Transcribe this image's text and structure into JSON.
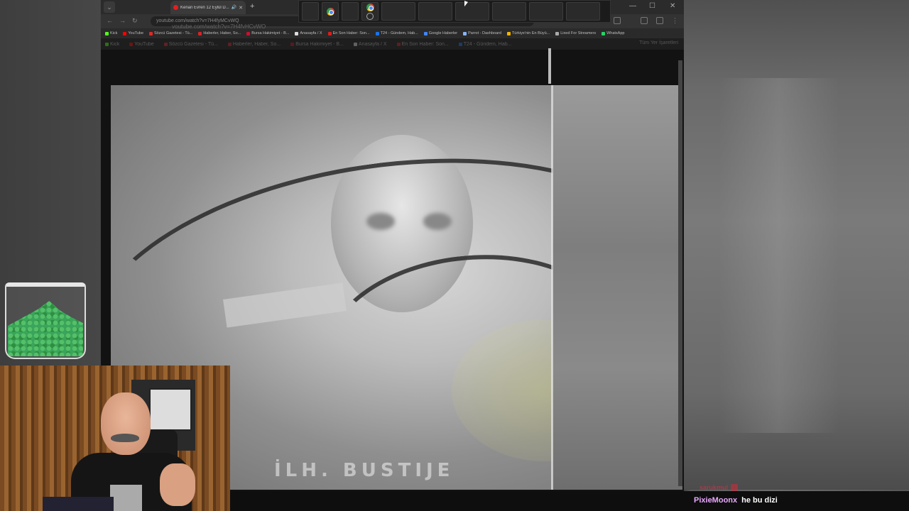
{
  "browser": {
    "tab_title": "Kenan Evren 12 Eylül D...",
    "tab_close": "✕",
    "new_tab": "+",
    "window_controls": [
      "—",
      "☐",
      "✕"
    ],
    "url": "youtube.com/watch?v=7H4fyMCvWQ",
    "url_ghost": "youtube.com/watch?v=7H4fyHCvWQ"
  },
  "bookmarks": [
    {
      "label": "Kick",
      "color": "#53fc18"
    },
    {
      "label": "YouTube",
      "color": "#ff0000"
    },
    {
      "label": "Sözcü Gazetesi - Tü...",
      "color": "#e02828"
    },
    {
      "label": "Haberler, Haber, So...",
      "color": "#d0262b"
    },
    {
      "label": "Bursa Hakimiyet - B...",
      "color": "#c8102e"
    },
    {
      "label": "Anasayfa / X",
      "color": "#dddddd"
    },
    {
      "label": "En Son Haber: Son...",
      "color": "#d42020"
    },
    {
      "label": "T24 - Gündem, Hab...",
      "color": "#1a73e8"
    },
    {
      "label": "Google Haberler",
      "color": "#4285f4"
    },
    {
      "label": "Parrot - Dashboard",
      "color": "#8ab4f8"
    },
    {
      "label": "Türkiye'nin En Büyü...",
      "color": "#f4b400"
    },
    {
      "label": "Lixed For Streamers",
      "color": "#aaaaaa"
    },
    {
      "label": "WhatsApp",
      "color": "#25d366"
    }
  ],
  "bookmarks_ghost": [
    {
      "label": "Kick",
      "color": "#53fc18"
    },
    {
      "label": "YouTube",
      "color": "#ff0000"
    },
    {
      "label": "Sözcü Gazetesi - Tü...",
      "color": "#e02828"
    },
    {
      "label": "Haberler, Haber, So...",
      "color": "#d0262b"
    },
    {
      "label": "Bursa Hakimiyet - B...",
      "color": "#c8102e"
    },
    {
      "label": "Anasayfa / X",
      "color": "#dddddd"
    },
    {
      "label": "En Son Haber: Son...",
      "color": "#d42020"
    },
    {
      "label": "T24 - Gündem, Hab...",
      "color": "#1a73e8"
    }
  ],
  "all_bookmarks": "Tüm Yer İşaretleri",
  "video": {
    "caption_text": "İLH. BUSTIJE"
  },
  "chat": {
    "ghost_user": "sarukmul",
    "username": "PixieMoonx",
    "message": "he bu dizi"
  }
}
